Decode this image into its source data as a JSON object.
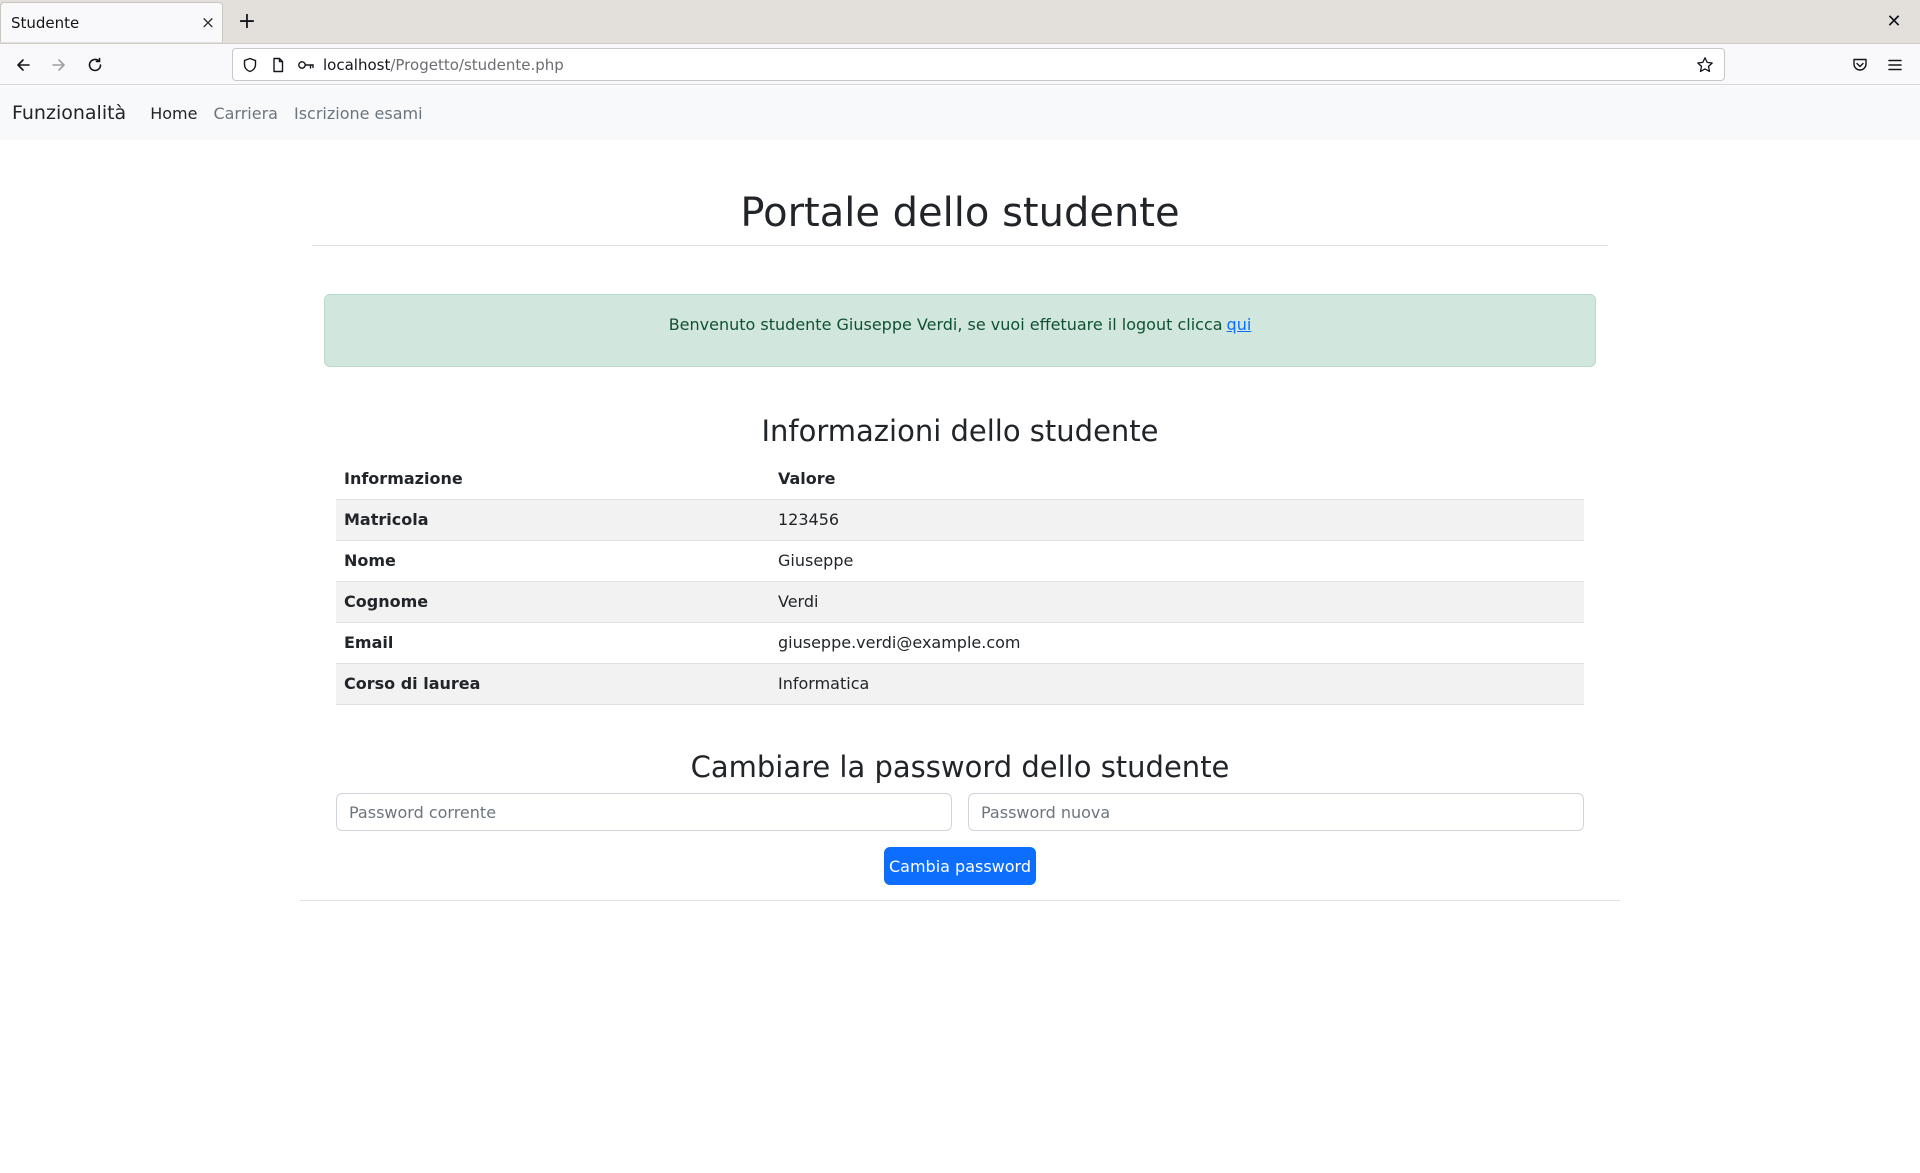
{
  "browser": {
    "tab_title": "Studente",
    "tab_close": "×",
    "new_tab": "+",
    "window_close": "✕",
    "url_host": "localhost",
    "url_path": "/Progetto/studente.php"
  },
  "navbar": {
    "brand": "Funzionalità",
    "links": [
      {
        "label": "Home",
        "active": true
      },
      {
        "label": "Carriera",
        "active": false
      },
      {
        "label": "Iscrizione esami",
        "active": false
      }
    ]
  },
  "page": {
    "title": "Portale dello studente",
    "welcome_text": "Benvenuto studente Giuseppe Verdi, se vuoi effetuare il logout clicca",
    "logout_link": "qui"
  },
  "student_info": {
    "title": "Informazioni dello studente",
    "headers": [
      "Informazione",
      "Valore"
    ],
    "rows": [
      {
        "label": "Matricola",
        "value": "123456"
      },
      {
        "label": "Nome",
        "value": "Giuseppe"
      },
      {
        "label": "Cognome",
        "value": "Verdi"
      },
      {
        "label": "Email",
        "value": "giuseppe.verdi@example.com"
      },
      {
        "label": "Corso di laurea",
        "value": "Informatica"
      }
    ]
  },
  "password_form": {
    "title": "Cambiare la password dello studente",
    "current_placeholder": "Password corrente",
    "new_placeholder": "Password nuova",
    "submit_label": "Cambia password"
  },
  "colors": {
    "primary": "#0d6efd",
    "alert_bg": "#d1e7dd",
    "alert_text": "#0f5132",
    "navbar_bg": "#f8f9fa"
  }
}
